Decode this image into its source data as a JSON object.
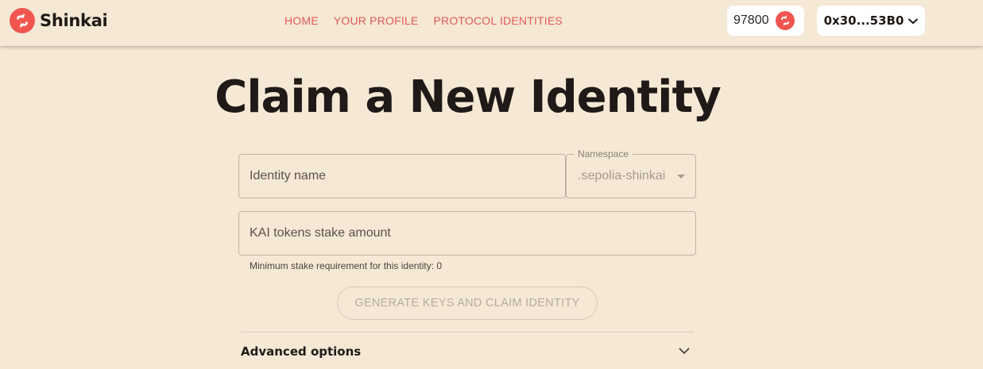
{
  "brand": {
    "name": "Shinkai",
    "color": "#f0564f"
  },
  "nav": {
    "items": [
      {
        "label": "HOME"
      },
      {
        "label": "YOUR PROFILE"
      },
      {
        "label": "PROTOCOL IDENTITIES"
      }
    ],
    "link_color": "#e0595a"
  },
  "account": {
    "balance": "97800",
    "balance_icon": "shinkai-coin-icon",
    "wallet_address": "0x30...53B0",
    "wallet_icon": "chevron-down-icon"
  },
  "page": {
    "title": "Claim a New Identity"
  },
  "form": {
    "identity_name_placeholder": "Identity name",
    "namespace_label": "Namespace",
    "namespace_value": ".sepolia-shinkai",
    "stake_placeholder": "KAI tokens stake amount",
    "min_stake_helper": "Minimum stake requirement for this identity: 0",
    "submit_label": "GENERATE KEYS AND CLAIM IDENTITY"
  },
  "advanced": {
    "label": "Advanced options",
    "icon": "chevron-down-icon"
  },
  "colors": {
    "background": "#f5e8d5",
    "accent": "#f0564f"
  }
}
